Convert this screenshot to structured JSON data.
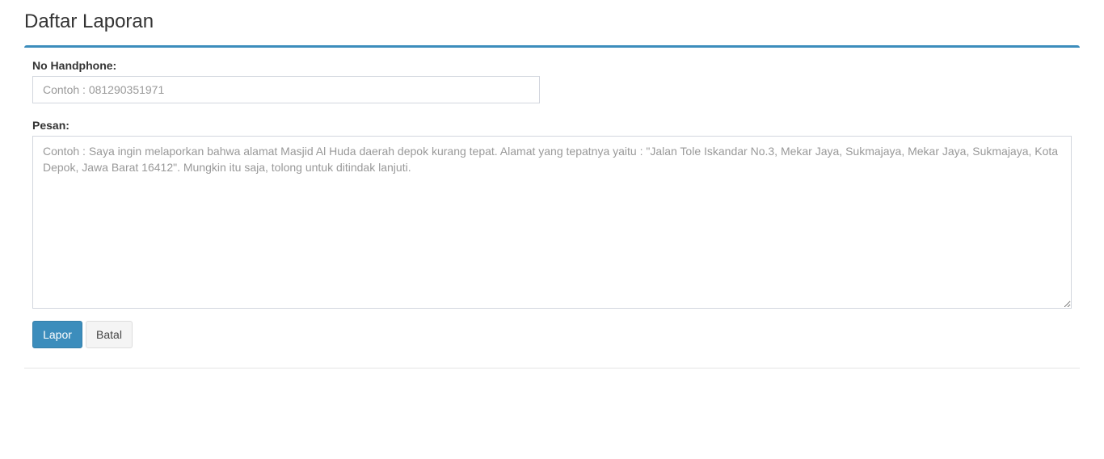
{
  "page": {
    "title": "Daftar Laporan"
  },
  "form": {
    "phone_label": "No Handphone:",
    "phone_value": "",
    "phone_placeholder": "Contoh : 081290351971",
    "message_label": "Pesan:",
    "message_value": "",
    "message_placeholder": "Contoh : Saya ingin melaporkan bahwa alamat Masjid Al Huda daerah depok kurang tepat. Alamat yang tepatnya yaitu : \"Jalan Tole Iskandar No.3, Mekar Jaya, Sukmajaya, Mekar Jaya, Sukmajaya, Kota Depok, Jawa Barat 16412\". Mungkin itu saja, tolong untuk ditindak lanjuti.",
    "submit_label": "Lapor",
    "cancel_label": "Batal"
  },
  "colors": {
    "accent": "#3c8dbc",
    "button_default_bg": "#f4f4f4",
    "input_border": "#d2d6de"
  }
}
